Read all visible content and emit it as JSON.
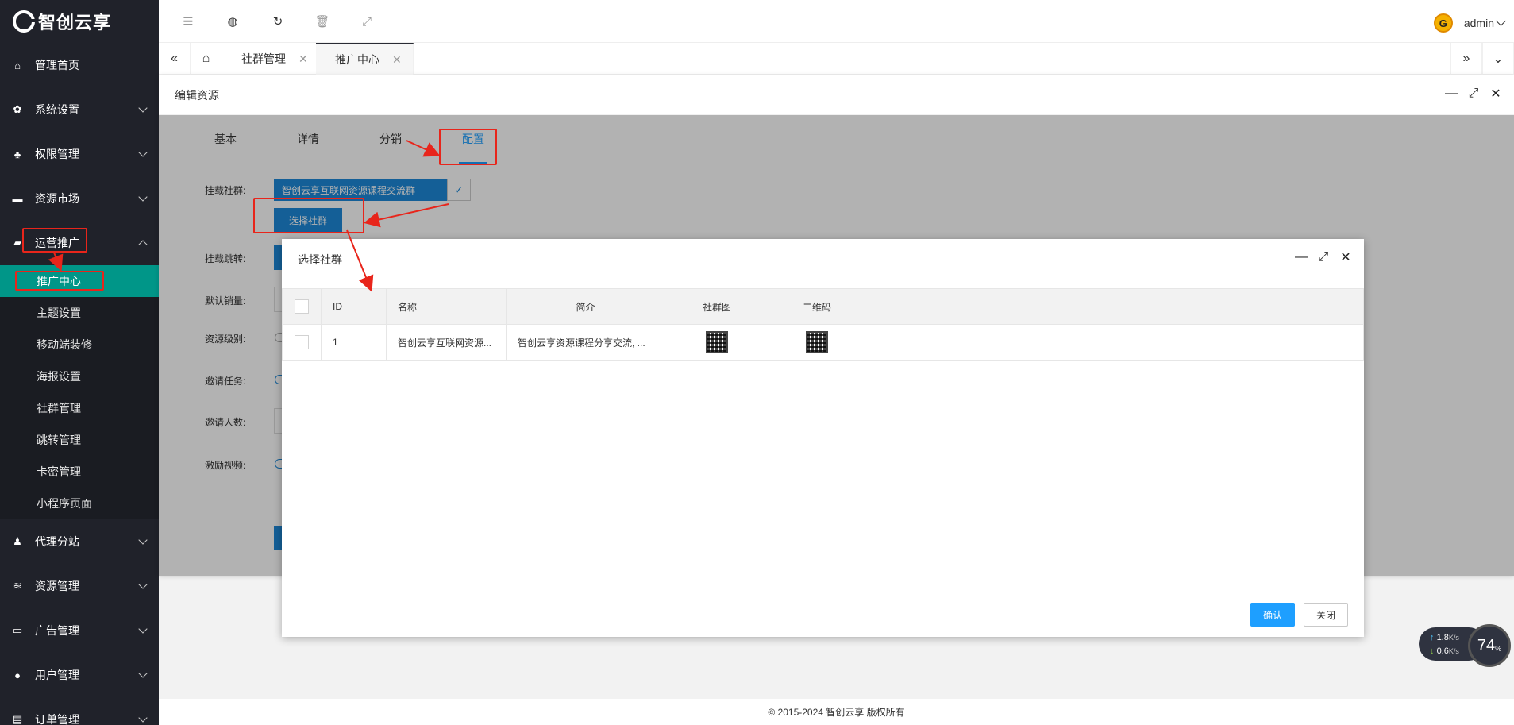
{
  "logo": {
    "text": "智创云享"
  },
  "sidebar": {
    "items": [
      {
        "label": "管理首页",
        "icon": "home-icon"
      },
      {
        "label": "系统设置",
        "icon": "gear-icon"
      },
      {
        "label": "权限管理",
        "icon": "users-icon"
      },
      {
        "label": "资源市场",
        "icon": "store-icon"
      },
      {
        "label": "运营推广",
        "icon": "chat-icon"
      },
      {
        "label": "代理分站",
        "icon": "agent-icon"
      },
      {
        "label": "资源管理",
        "icon": "layers-icon"
      },
      {
        "label": "广告管理",
        "icon": "ad-icon"
      },
      {
        "label": "用户管理",
        "icon": "user-icon"
      },
      {
        "label": "订单管理",
        "icon": "order-icon"
      }
    ],
    "subitems": [
      "推广中心",
      "主题设置",
      "移动端装修",
      "海报设置",
      "社群管理",
      "跳转管理",
      "卡密管理",
      "小程序页面"
    ]
  },
  "topbar": {
    "username": "admin"
  },
  "tabs": [
    {
      "label": "社群管理"
    },
    {
      "label": "推广中心"
    }
  ],
  "layer1": {
    "title": "编辑资源",
    "tabs": [
      "基本",
      "详情",
      "分销",
      "配置"
    ],
    "labels": {
      "community": "挂载社群:",
      "redirect": "挂载跳转:",
      "default_sales": "默认销量:",
      "level": "资源级别:",
      "invite_task": "邀请任务:",
      "invite_count": "邀请人数:",
      "reward_video": "激励视频:"
    },
    "selected_community": "智创云享互联网资源课程交流群",
    "select_button": "选择社群"
  },
  "layer2": {
    "title": "选择社群",
    "columns": [
      "ID",
      "名称",
      "简介",
      "社群图",
      "二维码"
    ],
    "rows": [
      {
        "id": "1",
        "name": "智创云享互联网资源...",
        "intro": "智创云享资源课程分享交流, ..."
      }
    ],
    "confirm": "确认",
    "close": "关闭"
  },
  "footer": {
    "text": "© 2015-2024 智创云享 版权所有"
  },
  "netmon": {
    "up": "1.8",
    "down": "0.6",
    "unit": "K/s",
    "percent": "74",
    "percent_sign": "%"
  },
  "colors": {
    "sidebar": "#20222a",
    "active": "#009688",
    "accent": "#1e9fff",
    "annotation": "#e8251b"
  }
}
